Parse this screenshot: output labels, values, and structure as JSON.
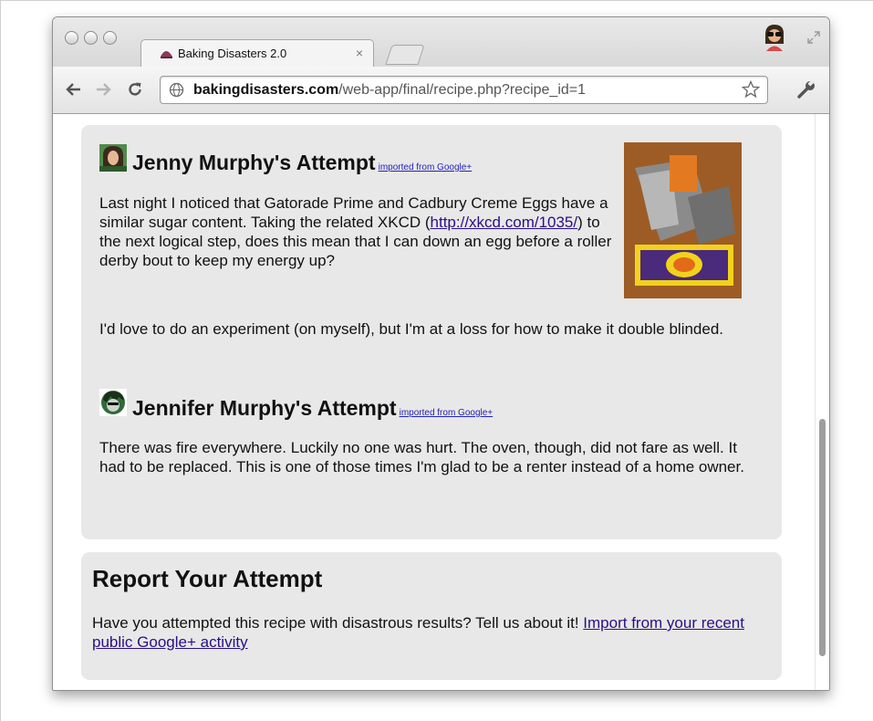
{
  "browser": {
    "tab_title": "Baking Disasters 2.0",
    "tab_close": "×",
    "url_host": "bakingdisasters.com",
    "url_path": "/web-app/final/recipe.php?recipe_id=1"
  },
  "attempts": [
    {
      "title": "Jenny Murphy's Attempt",
      "imported_label": "imported from Google+",
      "paragraph1_before_link": "Last night I noticed that Gatorade Prime and Cadbury Creme Eggs have a similar sugar content. Taking the related XKCD (",
      "paragraph1_link": "http://xkcd.com/1035/",
      "paragraph1_after_link": ") to the next logical step, does this mean that I can down an egg before a roller derby bout to keep my energy up?",
      "paragraph2": "I'd love to do an experiment (on myself), but I'm at a loss for how to make it double blinded."
    },
    {
      "title": "Jennifer Murphy's Attempt",
      "imported_label": "imported from Google+",
      "paragraph1": "There was fire everywhere. Luckily no one was hurt. The oven, though, did not fare as well. It had to be replaced. This is one of those times I'm glad to be a renter instead of a home owner."
    }
  ],
  "report": {
    "title": "Report Your Attempt",
    "text": "Have you attempted this recipe with disastrous results? Tell us about it! ",
    "link": "Import from your recent public Google+ activity"
  },
  "icons": {
    "traffic_lights": [
      "window-close-icon",
      "window-minimize-icon",
      "window-zoom-icon"
    ],
    "toolbar": [
      "back-arrow-icon",
      "forward-arrow-icon",
      "reload-icon",
      "globe-icon",
      "bookmark-star-icon",
      "wrench-icon"
    ]
  }
}
